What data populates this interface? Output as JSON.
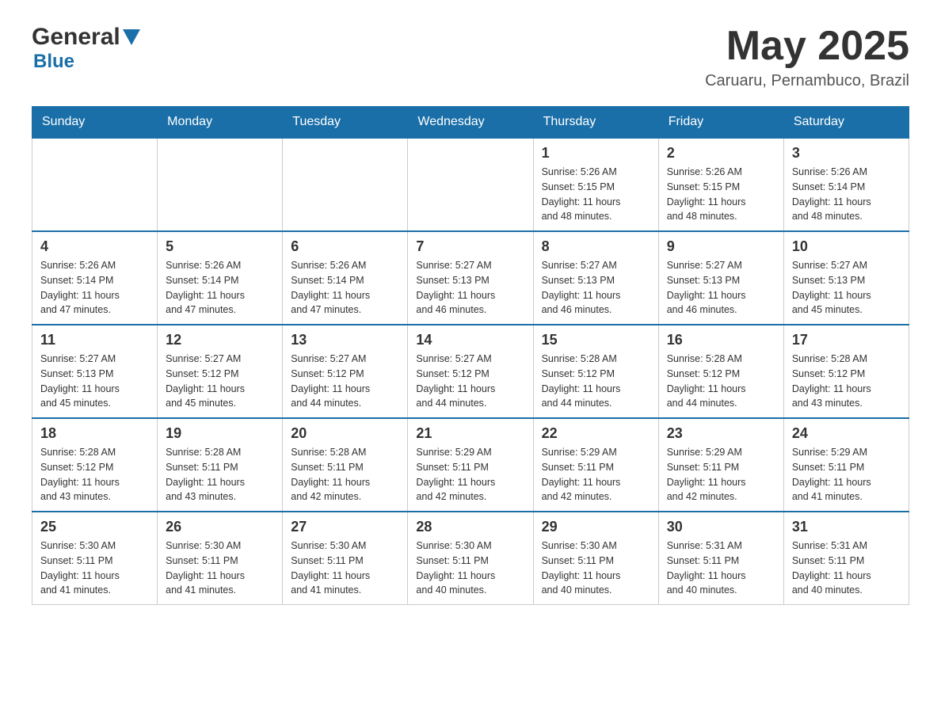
{
  "header": {
    "logo_general": "General",
    "logo_blue": "Blue",
    "title": "May 2025",
    "subtitle": "Caruaru, Pernambuco, Brazil"
  },
  "calendar": {
    "days_of_week": [
      "Sunday",
      "Monday",
      "Tuesday",
      "Wednesday",
      "Thursday",
      "Friday",
      "Saturday"
    ],
    "weeks": [
      [
        {
          "day": "",
          "info": ""
        },
        {
          "day": "",
          "info": ""
        },
        {
          "day": "",
          "info": ""
        },
        {
          "day": "",
          "info": ""
        },
        {
          "day": "1",
          "info": "Sunrise: 5:26 AM\nSunset: 5:15 PM\nDaylight: 11 hours\nand 48 minutes."
        },
        {
          "day": "2",
          "info": "Sunrise: 5:26 AM\nSunset: 5:15 PM\nDaylight: 11 hours\nand 48 minutes."
        },
        {
          "day": "3",
          "info": "Sunrise: 5:26 AM\nSunset: 5:14 PM\nDaylight: 11 hours\nand 48 minutes."
        }
      ],
      [
        {
          "day": "4",
          "info": "Sunrise: 5:26 AM\nSunset: 5:14 PM\nDaylight: 11 hours\nand 47 minutes."
        },
        {
          "day": "5",
          "info": "Sunrise: 5:26 AM\nSunset: 5:14 PM\nDaylight: 11 hours\nand 47 minutes."
        },
        {
          "day": "6",
          "info": "Sunrise: 5:26 AM\nSunset: 5:14 PM\nDaylight: 11 hours\nand 47 minutes."
        },
        {
          "day": "7",
          "info": "Sunrise: 5:27 AM\nSunset: 5:13 PM\nDaylight: 11 hours\nand 46 minutes."
        },
        {
          "day": "8",
          "info": "Sunrise: 5:27 AM\nSunset: 5:13 PM\nDaylight: 11 hours\nand 46 minutes."
        },
        {
          "day": "9",
          "info": "Sunrise: 5:27 AM\nSunset: 5:13 PM\nDaylight: 11 hours\nand 46 minutes."
        },
        {
          "day": "10",
          "info": "Sunrise: 5:27 AM\nSunset: 5:13 PM\nDaylight: 11 hours\nand 45 minutes."
        }
      ],
      [
        {
          "day": "11",
          "info": "Sunrise: 5:27 AM\nSunset: 5:13 PM\nDaylight: 11 hours\nand 45 minutes."
        },
        {
          "day": "12",
          "info": "Sunrise: 5:27 AM\nSunset: 5:12 PM\nDaylight: 11 hours\nand 45 minutes."
        },
        {
          "day": "13",
          "info": "Sunrise: 5:27 AM\nSunset: 5:12 PM\nDaylight: 11 hours\nand 44 minutes."
        },
        {
          "day": "14",
          "info": "Sunrise: 5:27 AM\nSunset: 5:12 PM\nDaylight: 11 hours\nand 44 minutes."
        },
        {
          "day": "15",
          "info": "Sunrise: 5:28 AM\nSunset: 5:12 PM\nDaylight: 11 hours\nand 44 minutes."
        },
        {
          "day": "16",
          "info": "Sunrise: 5:28 AM\nSunset: 5:12 PM\nDaylight: 11 hours\nand 44 minutes."
        },
        {
          "day": "17",
          "info": "Sunrise: 5:28 AM\nSunset: 5:12 PM\nDaylight: 11 hours\nand 43 minutes."
        }
      ],
      [
        {
          "day": "18",
          "info": "Sunrise: 5:28 AM\nSunset: 5:12 PM\nDaylight: 11 hours\nand 43 minutes."
        },
        {
          "day": "19",
          "info": "Sunrise: 5:28 AM\nSunset: 5:11 PM\nDaylight: 11 hours\nand 43 minutes."
        },
        {
          "day": "20",
          "info": "Sunrise: 5:28 AM\nSunset: 5:11 PM\nDaylight: 11 hours\nand 42 minutes."
        },
        {
          "day": "21",
          "info": "Sunrise: 5:29 AM\nSunset: 5:11 PM\nDaylight: 11 hours\nand 42 minutes."
        },
        {
          "day": "22",
          "info": "Sunrise: 5:29 AM\nSunset: 5:11 PM\nDaylight: 11 hours\nand 42 minutes."
        },
        {
          "day": "23",
          "info": "Sunrise: 5:29 AM\nSunset: 5:11 PM\nDaylight: 11 hours\nand 42 minutes."
        },
        {
          "day": "24",
          "info": "Sunrise: 5:29 AM\nSunset: 5:11 PM\nDaylight: 11 hours\nand 41 minutes."
        }
      ],
      [
        {
          "day": "25",
          "info": "Sunrise: 5:30 AM\nSunset: 5:11 PM\nDaylight: 11 hours\nand 41 minutes."
        },
        {
          "day": "26",
          "info": "Sunrise: 5:30 AM\nSunset: 5:11 PM\nDaylight: 11 hours\nand 41 minutes."
        },
        {
          "day": "27",
          "info": "Sunrise: 5:30 AM\nSunset: 5:11 PM\nDaylight: 11 hours\nand 41 minutes."
        },
        {
          "day": "28",
          "info": "Sunrise: 5:30 AM\nSunset: 5:11 PM\nDaylight: 11 hours\nand 40 minutes."
        },
        {
          "day": "29",
          "info": "Sunrise: 5:30 AM\nSunset: 5:11 PM\nDaylight: 11 hours\nand 40 minutes."
        },
        {
          "day": "30",
          "info": "Sunrise: 5:31 AM\nSunset: 5:11 PM\nDaylight: 11 hours\nand 40 minutes."
        },
        {
          "day": "31",
          "info": "Sunrise: 5:31 AM\nSunset: 5:11 PM\nDaylight: 11 hours\nand 40 minutes."
        }
      ]
    ]
  }
}
